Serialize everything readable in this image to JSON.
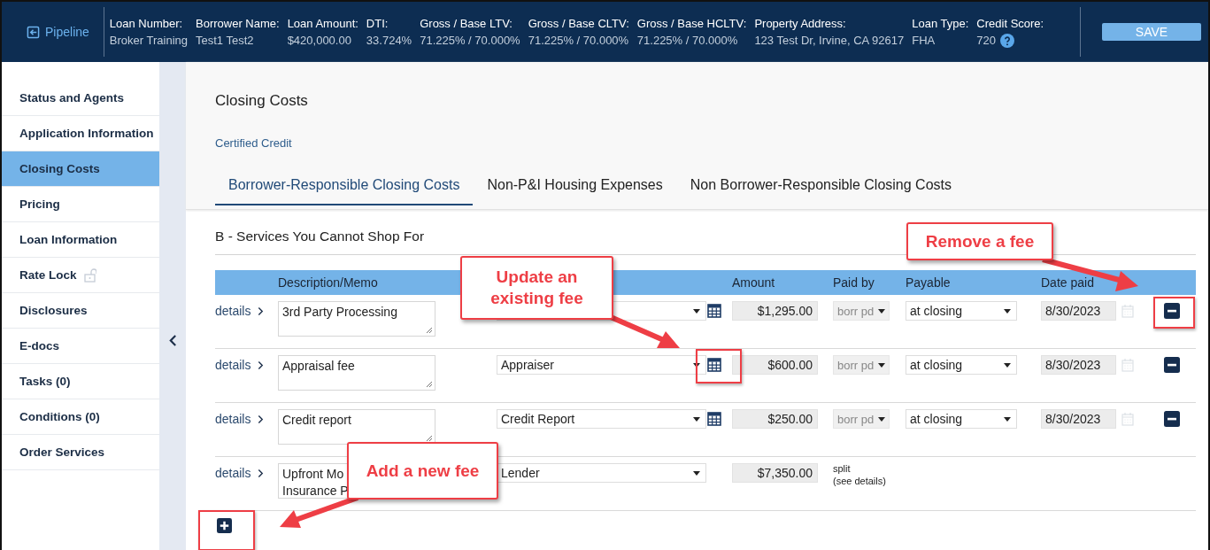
{
  "header": {
    "back_link": "Pipeline",
    "fields": [
      {
        "label": "Loan Number:",
        "value": "Broker Training"
      },
      {
        "label": "Borrower Name:",
        "value": "Test1 Test2"
      },
      {
        "label": "Loan Amount:",
        "value": "$420,000.00"
      },
      {
        "label": "DTI:",
        "value": "33.724%"
      },
      {
        "label": "Gross / Base LTV:",
        "value": "71.225% / 70.000%"
      },
      {
        "label": "Gross / Base CLTV:",
        "value": "71.225% / 70.000%"
      },
      {
        "label": "Gross / Base HCLTV:",
        "value": "71.225% / 70.000%"
      },
      {
        "label": "Property Address:",
        "value": "123 Test Dr, Irvine, CA 92617"
      },
      {
        "label": "Loan Type:",
        "value": "FHA"
      },
      {
        "label": "Credit Score:",
        "value": "720",
        "help": true
      }
    ],
    "save_button": "SAVE"
  },
  "sidebar": {
    "items": [
      {
        "label": "Status and Agents",
        "selected": false
      },
      {
        "label": "Application Information",
        "selected": false
      },
      {
        "label": "Closing Costs",
        "selected": true
      },
      {
        "label": "Pricing",
        "selected": false
      },
      {
        "label": "Loan Information",
        "selected": false
      },
      {
        "label": "Rate Lock",
        "selected": false,
        "locked": false
      },
      {
        "label": "Disclosures",
        "selected": false
      },
      {
        "label": "E-docs",
        "selected": false
      },
      {
        "label": "Tasks (0)",
        "selected": false
      },
      {
        "label": "Conditions (0)",
        "selected": false
      },
      {
        "label": "Order Services",
        "selected": false
      }
    ]
  },
  "page": {
    "title": "Closing Costs",
    "link": "Certified Credit",
    "tabs": [
      {
        "label": "Borrower-Responsible Closing Costs",
        "selected": true
      },
      {
        "label": "Non-P&I Housing Expenses",
        "selected": false
      },
      {
        "label": "Non Borrower-Responsible Closing Costs",
        "selected": false
      }
    ],
    "section_title": "B - Services You Cannot Shop For",
    "table": {
      "columns": [
        {
          "label": "Description/Memo"
        },
        {
          "label": "Amount"
        },
        {
          "label": "Paid by"
        },
        {
          "label": "Payable"
        },
        {
          "label": "Date paid"
        }
      ],
      "rows": [
        {
          "kind": "fee",
          "details": "details",
          "description": "3rd Party Processing",
          "calculator": true,
          "amount": "$1,295.00",
          "paid_by": {
            "value": "borr pd",
            "disabled": true
          },
          "payable": "at closing",
          "date_paid": "8/30/2023",
          "removable": true
        },
        {
          "kind": "fee",
          "details": "details",
          "description": "Appraisal fee",
          "payee": "Appraiser",
          "calculator": true,
          "amount": "$600.00",
          "paid_by": {
            "value": "borr pd",
            "disabled": true
          },
          "payable": "at closing",
          "date_paid": "8/30/2023",
          "removable": true
        },
        {
          "kind": "fee",
          "details": "details",
          "description": "Credit report",
          "payee": "Credit Report",
          "calculator": true,
          "amount": "$250.00",
          "paid_by": {
            "value": "borr pd",
            "disabled": true
          },
          "payable": "at closing",
          "date_paid": "8/30/2023",
          "removable": true
        },
        {
          "kind": "split",
          "details": "details",
          "description": "Upfront Mo\nInsurance P",
          "payee": "Lender",
          "calculator": false,
          "amount": "$7,350.00",
          "split_text": "split",
          "split_note": "(see details)",
          "removable": false
        }
      ]
    }
  },
  "callouts": [
    {
      "kind": "update",
      "text": "Update an existing fee"
    },
    {
      "kind": "remove",
      "text": "Remove a fee"
    },
    {
      "kind": "add",
      "text": "Add a new fee"
    }
  ]
}
